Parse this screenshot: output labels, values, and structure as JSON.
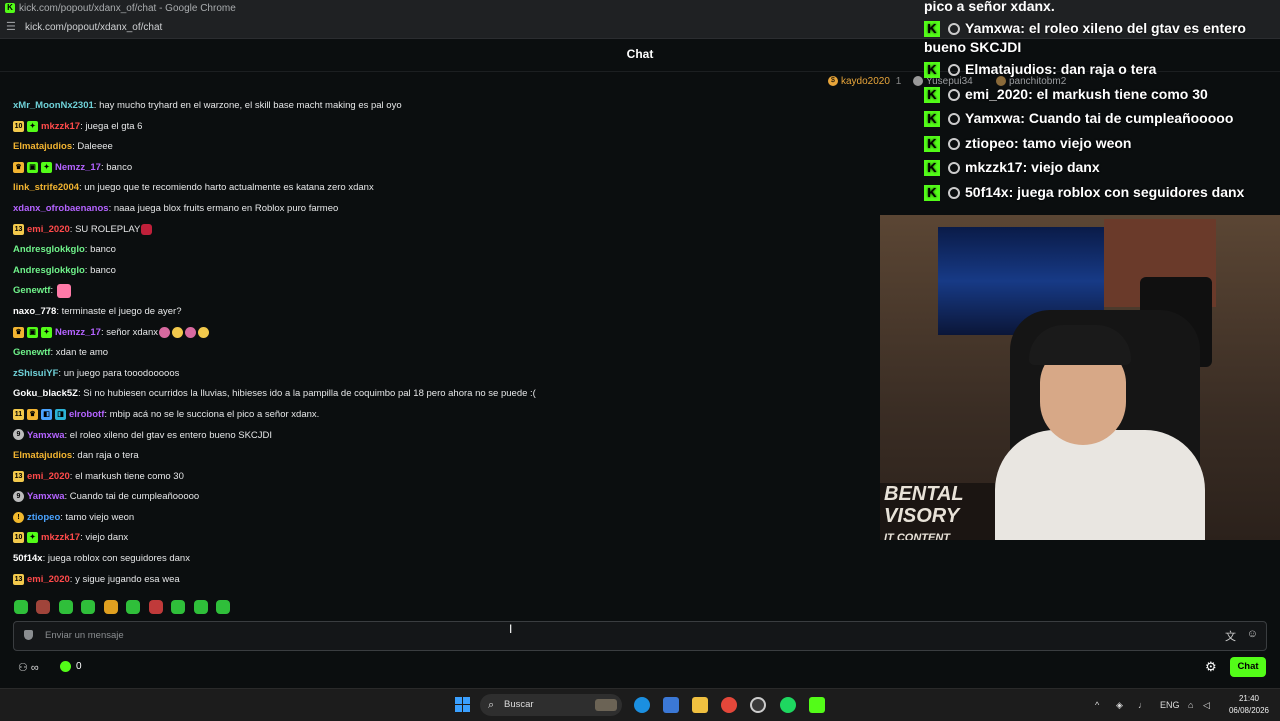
{
  "browser": {
    "title": "kick.com/popout/xdanx_of/chat - Google Chrome",
    "url": "kick.com/popout/xdanx_of/chat"
  },
  "chat_header": {
    "title": "Chat"
  },
  "pinned_users": [
    {
      "name": "kaydo2020",
      "num": "1",
      "color": "#e8a53a"
    },
    {
      "name": "Yusepui34",
      "color": "#9a9c9f"
    },
    {
      "name": "panchitobm2",
      "color": "#9a9c9f"
    }
  ],
  "messages": [
    {
      "user": "xMr_MoonNx2301",
      "color": "#6fd1d8",
      "badges": [],
      "text": "hay mucho tryhard en el warzone, el skill base macht making es pal oyo"
    },
    {
      "user": "mkzzk17",
      "color": "#ff4a4a",
      "badges": [
        "10",
        "gift"
      ],
      "text": "juega el gta 6"
    },
    {
      "user": "Elmatajudios",
      "color": "#f2b431",
      "badges": [],
      "text": "Daleeee"
    },
    {
      "user": "Nemzz_17",
      "color": "#b463ff",
      "badges": [
        "crown",
        "gift2",
        "gift"
      ],
      "text": "banco"
    },
    {
      "user": "link_strife2004",
      "color": "#f2b431",
      "badges": [],
      "text": "un juego que te recomiendo harto actualmente es katana zero xdanx"
    },
    {
      "user": "xdanx_ofrobaenanos",
      "color": "#b463ff",
      "badges": [],
      "text": "naaa juega blox fruits ermano en Roblox puro farmeo"
    },
    {
      "user": "emi_2020",
      "color": "#ff4a4a",
      "badges": [
        "13"
      ],
      "text": "SU ROLEPLAY"
    },
    {
      "user": "Andresglokkglo",
      "color": "#6ff28a",
      "badges": [],
      "text": "banco"
    },
    {
      "user": "Andresglokkglo",
      "color": "#6ff28a",
      "badges": [],
      "text": "banco"
    },
    {
      "user": "Genewtf",
      "color": "#6ff28a",
      "badges": [],
      "text": ""
    },
    {
      "user": "naxo_778",
      "color": "#ffffff",
      "badges": [],
      "text": "terminaste el juego de ayer?"
    },
    {
      "user": "Nemzz_17",
      "color": "#b463ff",
      "badges": [
        "crown",
        "gift2",
        "gift"
      ],
      "text": "señor xdanx"
    },
    {
      "user": "Genewtf",
      "color": "#6ff28a",
      "badges": [],
      "text": "xdan te amo"
    },
    {
      "user": "zShisuiYF",
      "color": "#6fd1d8",
      "badges": [],
      "text": "un juego para tooodooooos"
    },
    {
      "user": "Goku_black5Z",
      "color": "#ffffff",
      "badges": [],
      "text": "Si no hubiesen ocurridos la lluvias, hibieses ido a la pampilla de coquimbo pal 18 pero ahora no se puede :("
    },
    {
      "user": "elrobotf",
      "color": "#b463ff",
      "badges": [
        "11",
        "crown",
        "og",
        "vip"
      ],
      "text": "mbip acá no se le succiona el pico a señor xdanx."
    },
    {
      "user": "Yamxwa",
      "color": "#b463ff",
      "badges": [
        "circle"
      ],
      "text": "el roleo xileno del gtav es entero bueno SKCJDI"
    },
    {
      "user": "Elmatajudios",
      "color": "#f2b431",
      "badges": [],
      "text": "dan raja o tera"
    },
    {
      "user": "emi_2020",
      "color": "#ff4a4a",
      "badges": [
        "13"
      ],
      "text": "el markush tiene como 30"
    },
    {
      "user": "Yamxwa",
      "color": "#b463ff",
      "badges": [
        "circle"
      ],
      "text": "Cuando tai de cumpleañooooo"
    },
    {
      "user": "ztiopeo",
      "color": "#4aa3ff",
      "badges": [
        "gold"
      ],
      "text": "tamo viejo weon"
    },
    {
      "user": "mkzzk17",
      "color": "#ff4a4a",
      "badges": [
        "10",
        "gift"
      ],
      "text": "viejo danx"
    },
    {
      "user": "50f14x",
      "color": "#ffffff",
      "badges": [],
      "text": "juega roblox con seguidores danx"
    },
    {
      "user": "emi_2020",
      "color": "#ff4a4a",
      "badges": [
        "13"
      ],
      "text": "y sigue jugando esa wea"
    }
  ],
  "input": {
    "placeholder": "Enviar un mensaje"
  },
  "footer": {
    "points": "0",
    "chat_button": "Chat"
  },
  "overlay": {
    "top_text": "pico a señor xdanx.",
    "lines": [
      {
        "user": "Yamxwa",
        "text": "el roleo xileno del gtav es entero bueno SKCJDI"
      },
      {
        "user": "Elmatajudios",
        "text": "dan raja o tera"
      },
      {
        "user": "emi_2020",
        "text": "el markush tiene como 30"
      },
      {
        "user": "Yamxwa",
        "text": "Cuando tai de cumpleañooooo"
      },
      {
        "user": "ztiopeo",
        "text": "tamo viejo weon"
      },
      {
        "user": "mkzzk17",
        "text": "viejo danx"
      },
      {
        "user": "50f14x",
        "text": "juega roblox con seguidores danx"
      }
    ]
  },
  "webcam_sign": "BENTAL\nVISORY\nIT CONTENT",
  "taskbar": {
    "search": "Buscar",
    "lang": "ENG",
    "time": "21:40",
    "date": "06/08/2026"
  }
}
